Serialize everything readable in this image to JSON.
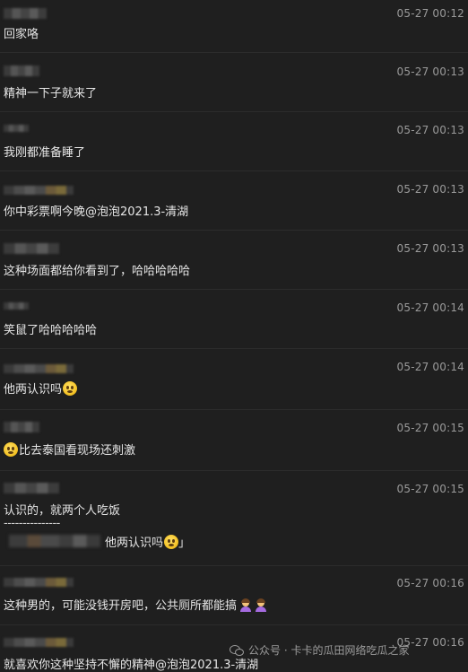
{
  "messages": [
    {
      "time": "05-27 00:12",
      "text": "回家咯"
    },
    {
      "time": "05-27 00:13",
      "text": "精神一下子就来了"
    },
    {
      "time": "05-27 00:13",
      "text": "我刚都准备睡了"
    },
    {
      "time": "05-27 00:13",
      "text": "你中彩票啊今晚@泡泡2021.3-清湖"
    },
    {
      "time": "05-27 00:13",
      "text": "这种场面都给你看到了，哈哈哈哈哈"
    },
    {
      "time": "05-27 00:14",
      "text": "笑鼠了哈哈哈哈哈"
    },
    {
      "time": "05-27 00:14",
      "text": "他两认识吗"
    },
    {
      "time": "05-27 00:15",
      "text": "比去泰国看现场还刺激"
    },
    {
      "time": "05-27 00:15",
      "text": "认识的，就两个人吃饭",
      "divider": "---------------",
      "quote_text": "他两认识吗",
      "quote_close": "」"
    },
    {
      "time": "05-27 00:16",
      "text": "这种男的，可能没钱开房吧，公共厕所都能搞"
    },
    {
      "time": "05-27 00:16",
      "text": "就喜欢你这种坚持不懈的精神@泡泡2021.3-清湖"
    }
  ],
  "watermark": {
    "text": "公众号 · 卡卡的瓜田网络吃瓜之家",
    "icon": "wechat-icon"
  },
  "colors": {
    "background": "#1f1f1f",
    "text": "#e6e6e6",
    "timestamp": "#9a9a9a",
    "separator": "#2c2c2c"
  }
}
